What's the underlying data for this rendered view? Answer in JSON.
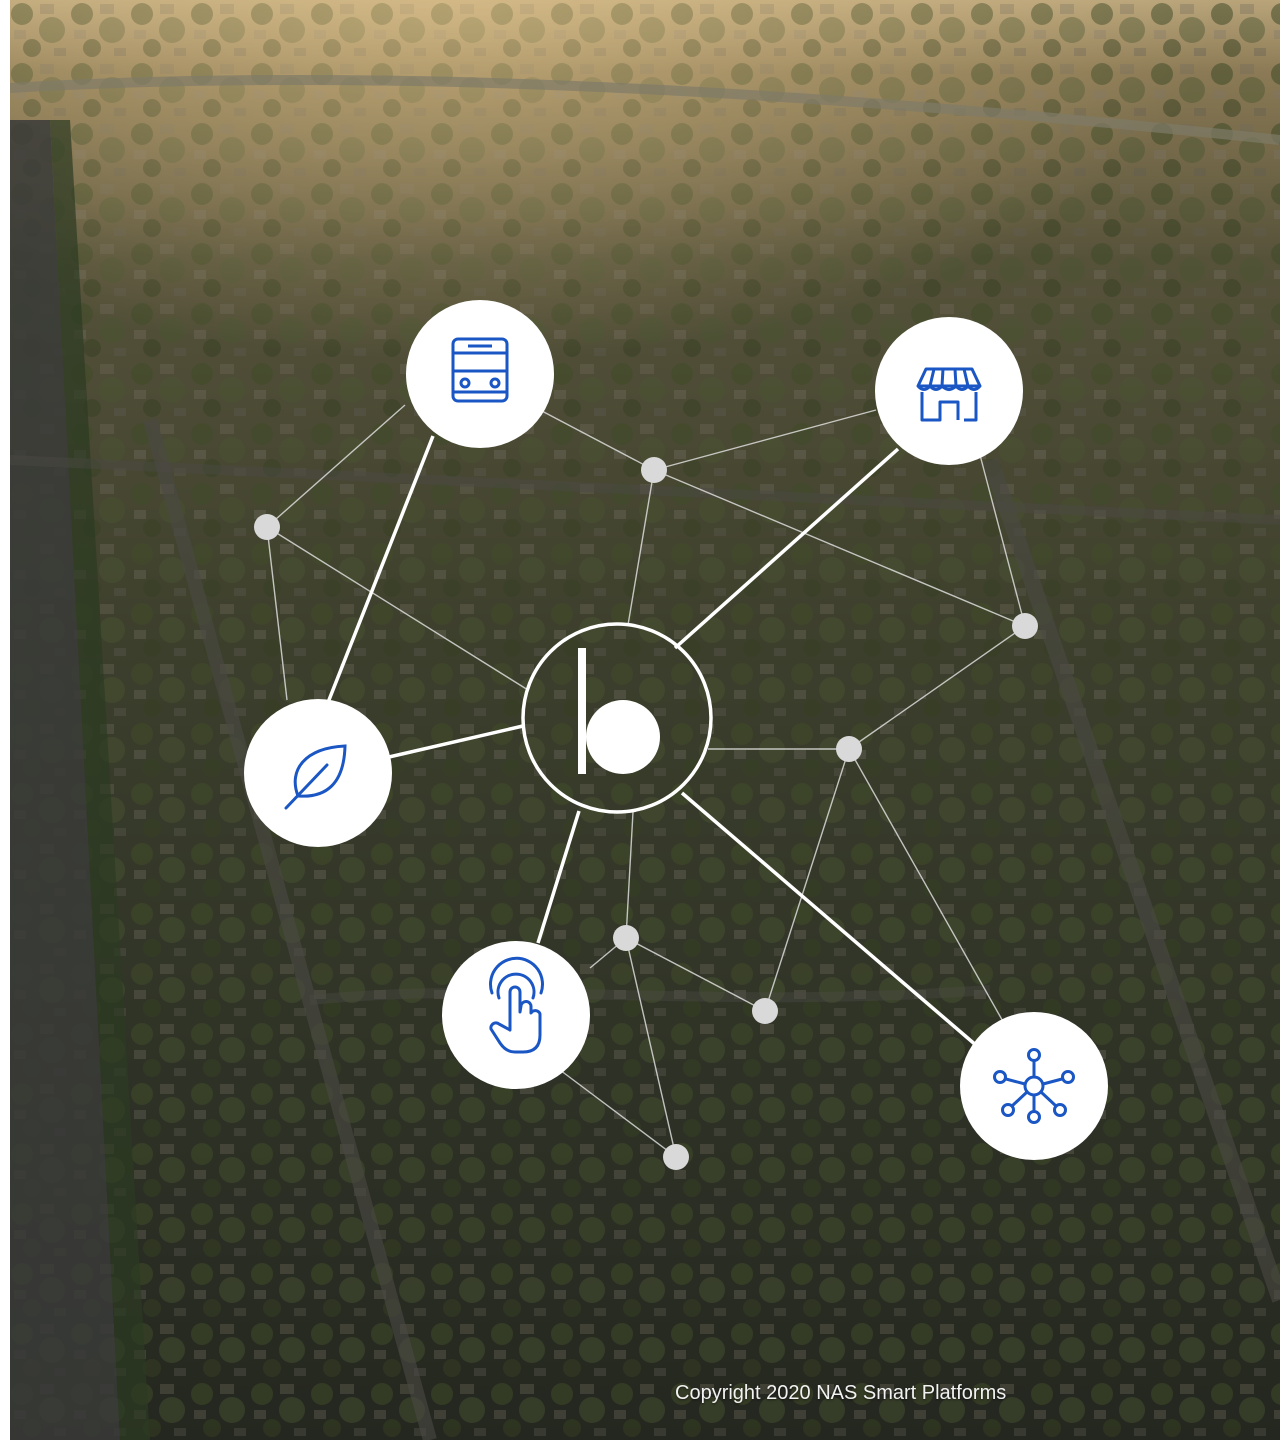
{
  "scene": {
    "background": "aerial-photo-of-suburban-neighborhood-at-sunset",
    "colors": {
      "icon_blue": "#1a56c4",
      "node_white": "#ffffff",
      "node_gray": "#d9d9d9",
      "line_white": "#ffffff"
    }
  },
  "hub": {
    "name": "hub-logo"
  },
  "icons": [
    {
      "id": "transport",
      "icon": "bus-icon"
    },
    {
      "id": "commerce",
      "icon": "storefront-icon"
    },
    {
      "id": "environment",
      "icon": "leaf-icon"
    },
    {
      "id": "interaction",
      "icon": "tap-gesture-icon"
    },
    {
      "id": "connectivity",
      "icon": "network-icon"
    }
  ],
  "copyright": "Copyright 2020 NAS Smart Platforms"
}
